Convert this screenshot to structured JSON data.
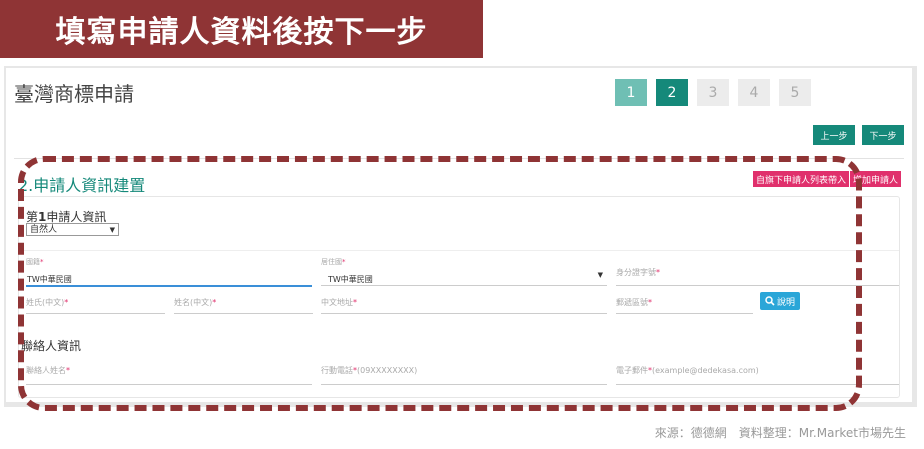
{
  "banner": {
    "text": "填寫申請人資料後按下一步"
  },
  "app": {
    "title": "臺灣商標申請"
  },
  "steps": [
    "1",
    "2",
    "3",
    "4",
    "5"
  ],
  "nav": {
    "prev": "上一步",
    "next": "下一步"
  },
  "section": {
    "title": "2.申請人資訊建置",
    "import_button": "自旗下申請人列表帶入",
    "add_button": "增加申請人"
  },
  "applicant": {
    "heading_prefix": "第",
    "heading_num": "1",
    "heading_suffix": "申請人資訊",
    "type_selected": "自然人",
    "nationality_label": "國籍",
    "nationality_value": "TW中華民國",
    "residence_label": "居住國",
    "residence_value": "TW中華民國",
    "id_label": "身分證字號",
    "surname_label": "姓氏(中文)",
    "given_label": "姓名(中文)",
    "address_label": "中文地址",
    "zip_label": "郵遞區號",
    "explain_button": "說明"
  },
  "contact": {
    "heading": "聯絡人資訊",
    "name_label": "聯絡人姓名",
    "mobile_label": "行動電話",
    "mobile_hint": "(09XXXXXXXX)",
    "email_label": "電子郵件",
    "email_hint": "(example@dedekasa.com)"
  },
  "credit": "來源：德德網　資料整理：Mr.Market市場先生",
  "colors": {
    "banner": "#8f3435",
    "teal": "#15897a",
    "pink": "#e0306c",
    "info": "#2aa6d8"
  }
}
